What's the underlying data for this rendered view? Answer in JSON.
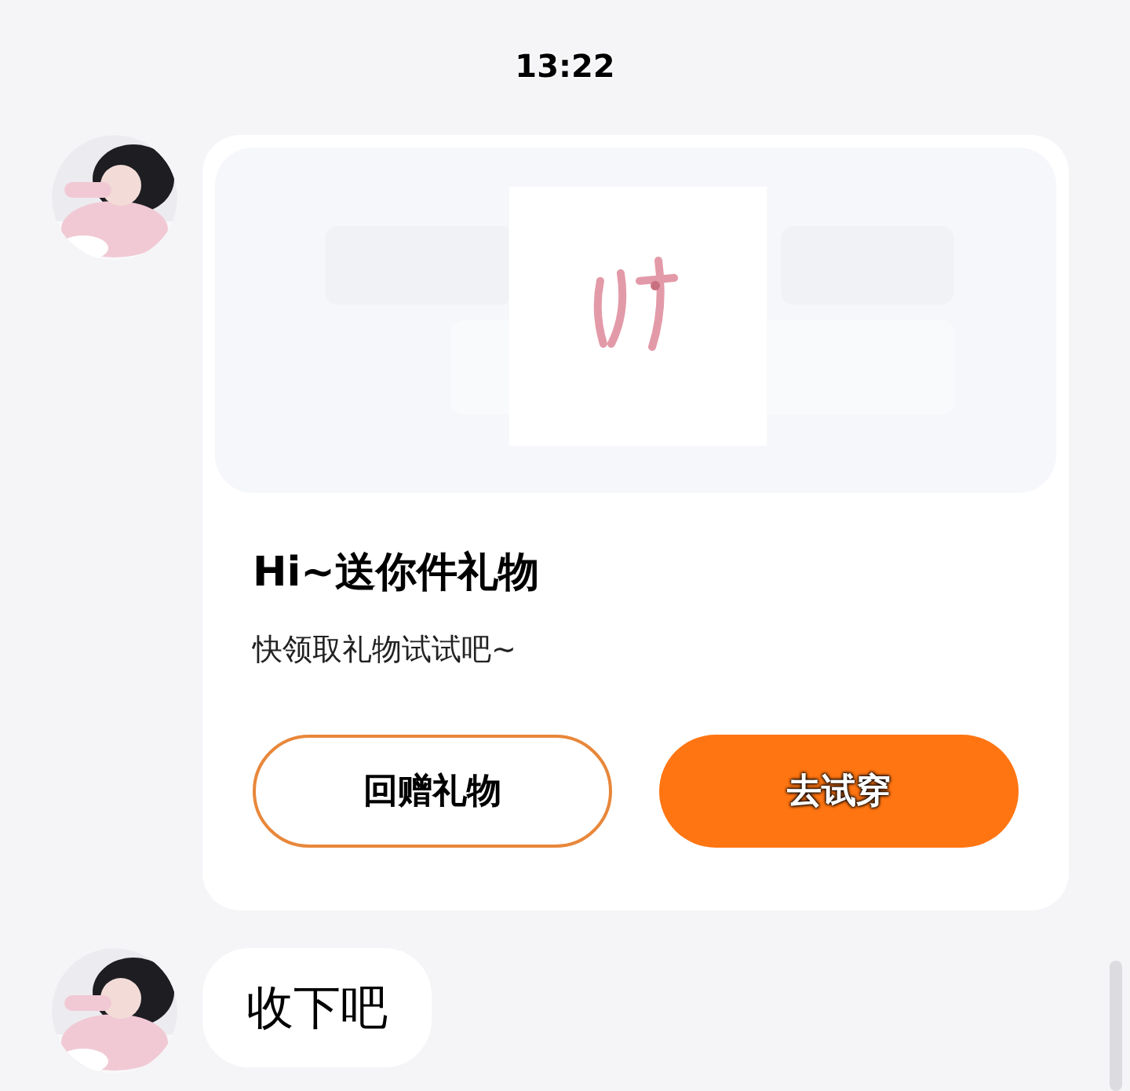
{
  "time": "13:22",
  "messages": [
    {
      "kind": "gift",
      "title": "Hi~送你件礼物",
      "text": "快领取礼物试试吧~",
      "actions": [
        {
          "kind": "outline",
          "label": "回赠礼物"
        },
        {
          "kind": "filled",
          "label": "去试穿"
        }
      ]
    },
    {
      "kind": "text",
      "text": "收下吧"
    }
  ]
}
